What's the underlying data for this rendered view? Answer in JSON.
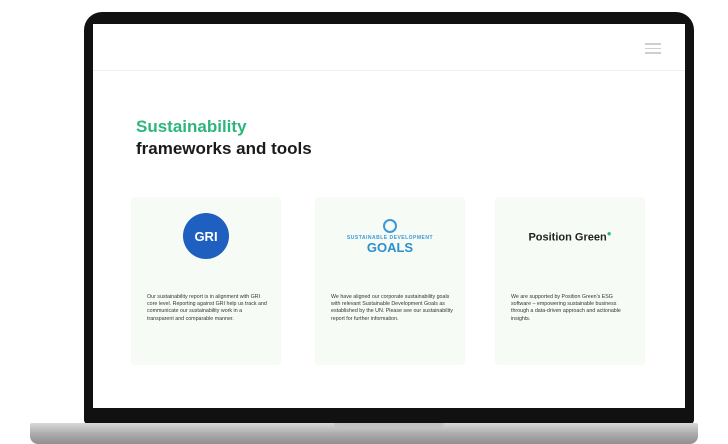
{
  "header": {
    "menu_icon": "hamburger-menu-icon"
  },
  "hero": {
    "title_line1": "Sustainability",
    "title_line2": "frameworks and tools"
  },
  "cards": [
    {
      "logo_text": "GRI",
      "description": "Our sustainability report is in alignment with GRI core level. Reporting against GRI help us track and communicate our sustainability work in a transparent and comparable manner."
    },
    {
      "logo_small": "SUSTAINABLE DEVELOPMENT",
      "logo_text": "GOALS",
      "description": "We have aligned our corporate sustainability goals with relevant Sustainable Development Goals as established by the UN. Please see our sustainability report for further information."
    },
    {
      "logo_text": "Position Green",
      "description": "We are supported by Position Green's ESG software – empowering sustainable business through a data-driven approach and actionable insights."
    }
  ],
  "colors": {
    "accent_green": "#2db67c",
    "gri_blue": "#1f5fbf",
    "sdg_blue": "#3a9ad9",
    "card_bg": "#f7fbf5"
  }
}
